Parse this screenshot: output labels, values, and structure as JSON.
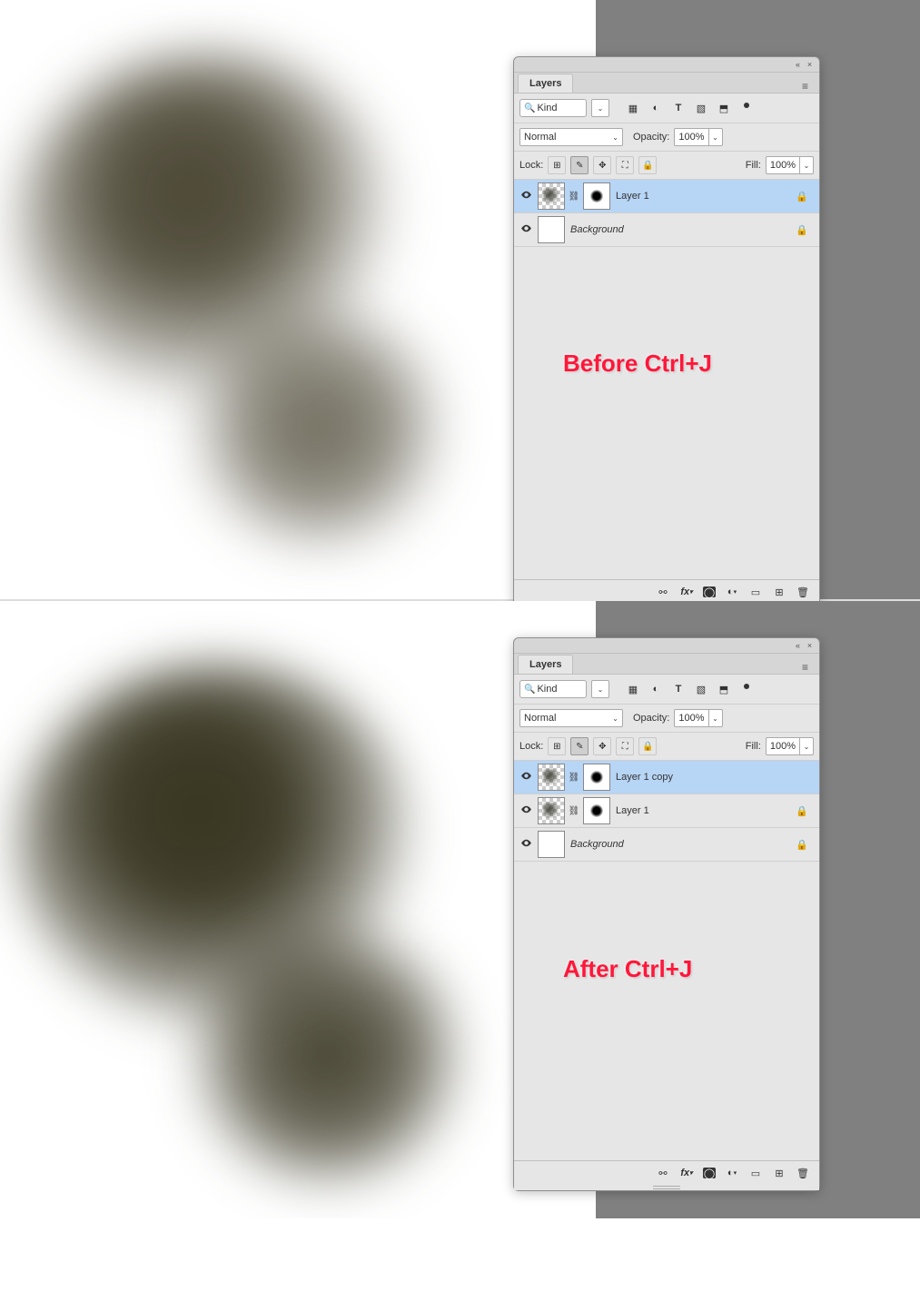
{
  "panel": {
    "tab": "Layers",
    "search_text": "Kind",
    "blend_mode": "Normal",
    "opacity_label": "Opacity:",
    "opacity_value": "100%",
    "lock_label": "Lock:",
    "fill_label": "Fill:",
    "fill_value": "100%"
  },
  "before": {
    "caption": "Before Ctrl+J",
    "layers": [
      {
        "name": "Layer 1",
        "selected": true,
        "hasMask": true,
        "checker": true,
        "locked": true,
        "italic": false
      },
      {
        "name": "Background",
        "selected": false,
        "hasMask": false,
        "checker": false,
        "locked": true,
        "italic": true
      }
    ]
  },
  "after": {
    "caption": "After Ctrl+J",
    "layers": [
      {
        "name": "Layer 1 copy",
        "selected": true,
        "hasMask": true,
        "checker": true,
        "locked": false,
        "italic": false
      },
      {
        "name": "Layer 1",
        "selected": false,
        "hasMask": true,
        "checker": true,
        "locked": true,
        "italic": false
      },
      {
        "name": "Background",
        "selected": false,
        "hasMask": false,
        "checker": false,
        "locked": true,
        "italic": true
      }
    ]
  },
  "filter_icons": [
    "image",
    "adjust",
    "text",
    "shape",
    "smart",
    "artboard"
  ],
  "lock_icons": [
    "transparent",
    "pixels",
    "position",
    "nested",
    "all"
  ],
  "footer_icons": [
    "link",
    "fx",
    "mask",
    "adjustment",
    "group",
    "new",
    "delete"
  ],
  "colors": {
    "annotation": "#ff173a",
    "selection": "#b7d5f5",
    "panel_bg": "#e6e6e6"
  }
}
